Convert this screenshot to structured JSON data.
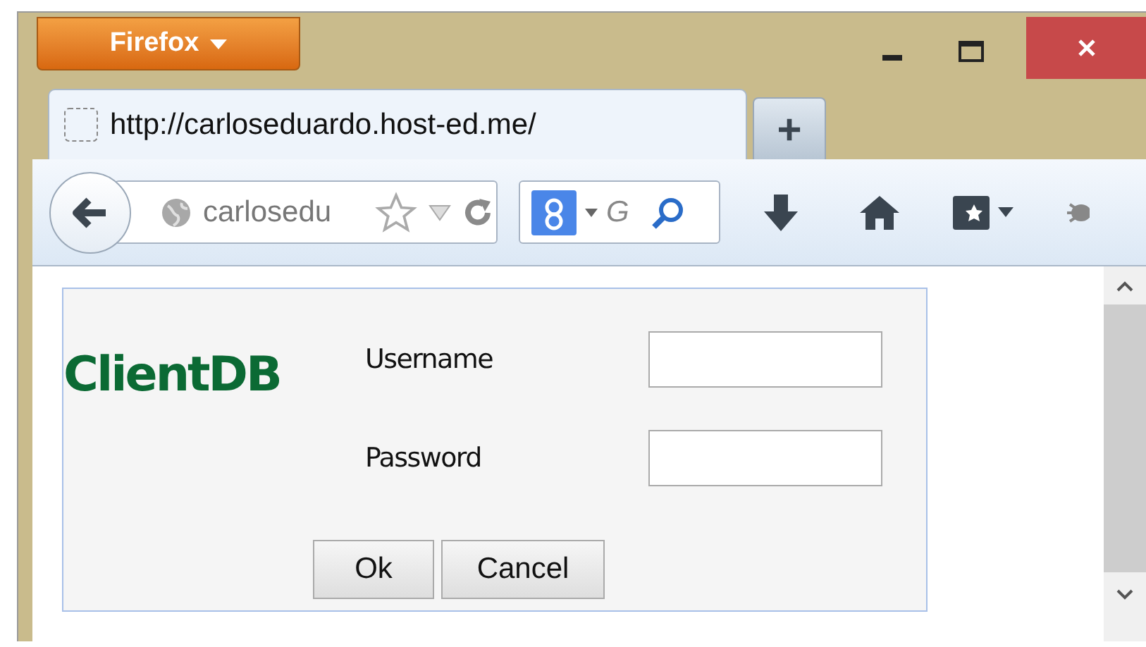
{
  "app_menu": {
    "label": "Firefox"
  },
  "tabs": [
    {
      "title": "http://carloseduardo.host-ed.me/",
      "selected": true
    }
  ],
  "new_tab": {
    "label": "+"
  },
  "url_bar": {
    "value": "carlosedu"
  },
  "search_bar": {
    "placeholder": "G"
  },
  "form": {
    "title": "ClientDB",
    "fields": [
      {
        "label": "Username"
      },
      {
        "label": "Password"
      }
    ],
    "buttons": [
      "Ok",
      "Cancel"
    ]
  }
}
